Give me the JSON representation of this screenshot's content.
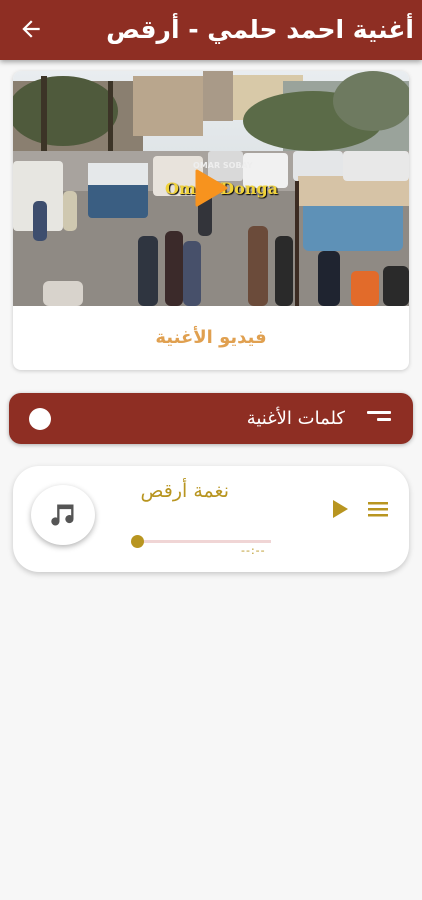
{
  "appbar": {
    "title": "أغنية احمد حلمي - أرقص",
    "back_icon": "arrow-back-icon",
    "color": "#8e2e23"
  },
  "video": {
    "label": "فيديو الأغنية",
    "watermark_top": "OMAR SOBAY",
    "watermark_main": "Omar Donga",
    "play_icon": "play-icon",
    "play_color": "#f7931e"
  },
  "lyrics": {
    "label": "كلمات الأغنية",
    "icon": "sort-icon"
  },
  "player": {
    "track_title": "نغمة أرقص",
    "time": "--:--",
    "progress": 0,
    "note_icon": "music-note-icon",
    "accent": "#b89520"
  }
}
